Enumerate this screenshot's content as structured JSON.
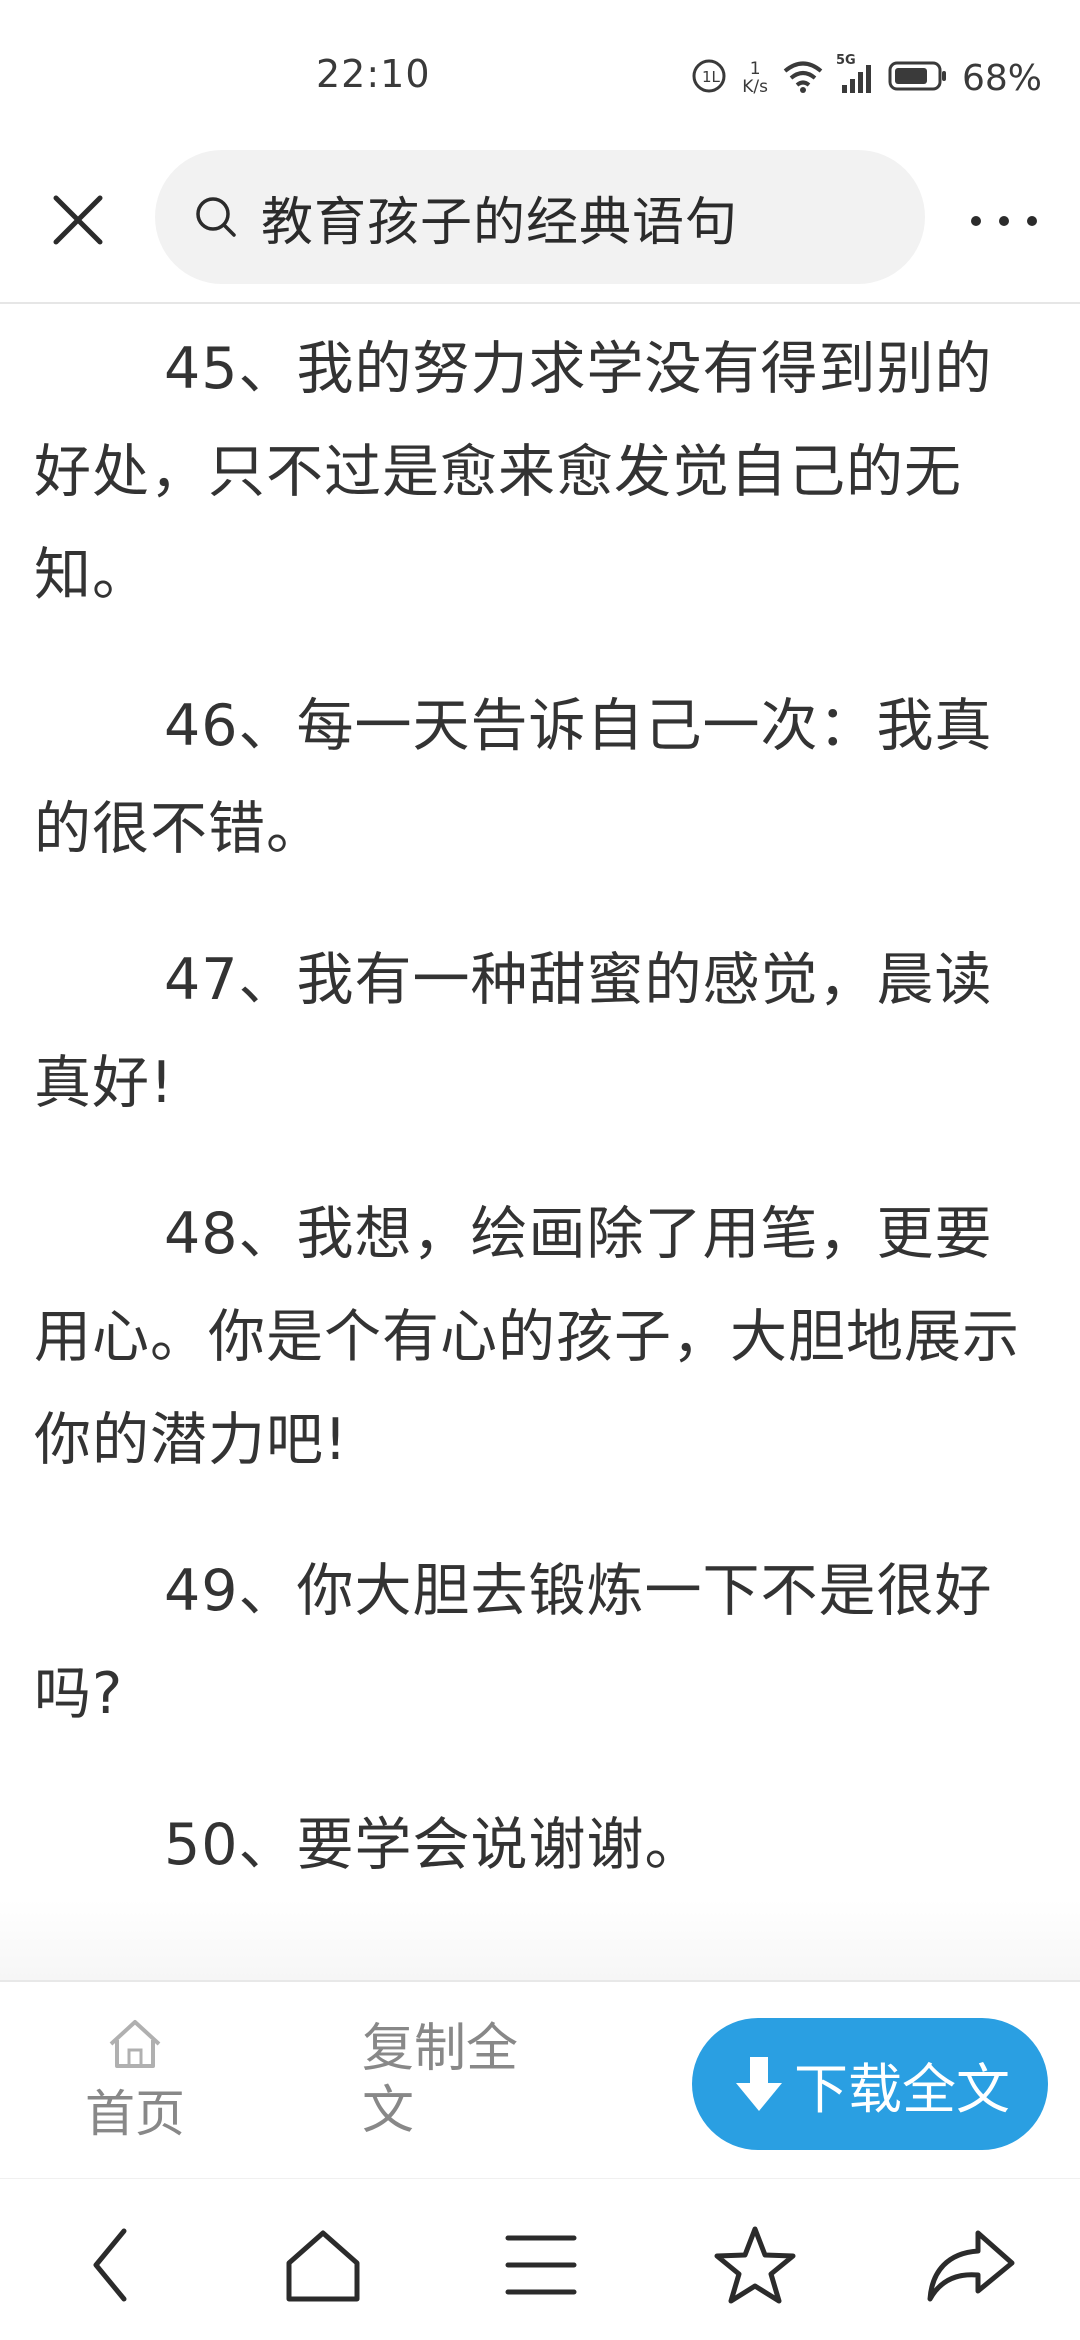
{
  "status_bar": {
    "time": "22:10",
    "net_speed_value": "1",
    "net_speed_unit": "K/s",
    "network_label": "5G",
    "battery_percent": "68%"
  },
  "header": {
    "search_query": "教育孩子的经典语句",
    "close_icon": "close-icon",
    "more_icon": "more-icon"
  },
  "article": {
    "paragraphs": [
      "45、我的努力求学没有得到别的好处，只不过是愈来愈发觉自己的无知。",
      "46、每一天告诉自己一次：我真的很不错。",
      "47、我有一种甜蜜的感觉，晨读真好!",
      "48、我想，绘画除了用笔，更要用心。你是个有心的孩子，大胆地展示你的潜力吧!",
      "49、你大胆去锻炼一下不是很好吗?",
      "50、要学会说谢谢。"
    ]
  },
  "action_bar": {
    "home_label": "首页",
    "copy_label": "复制全文",
    "download_label": "下载全文",
    "accent_color": "#2a9fe2"
  },
  "nav_bar": {
    "icons": [
      "back-icon",
      "home-icon",
      "menu-icon",
      "star-icon",
      "share-icon"
    ]
  }
}
